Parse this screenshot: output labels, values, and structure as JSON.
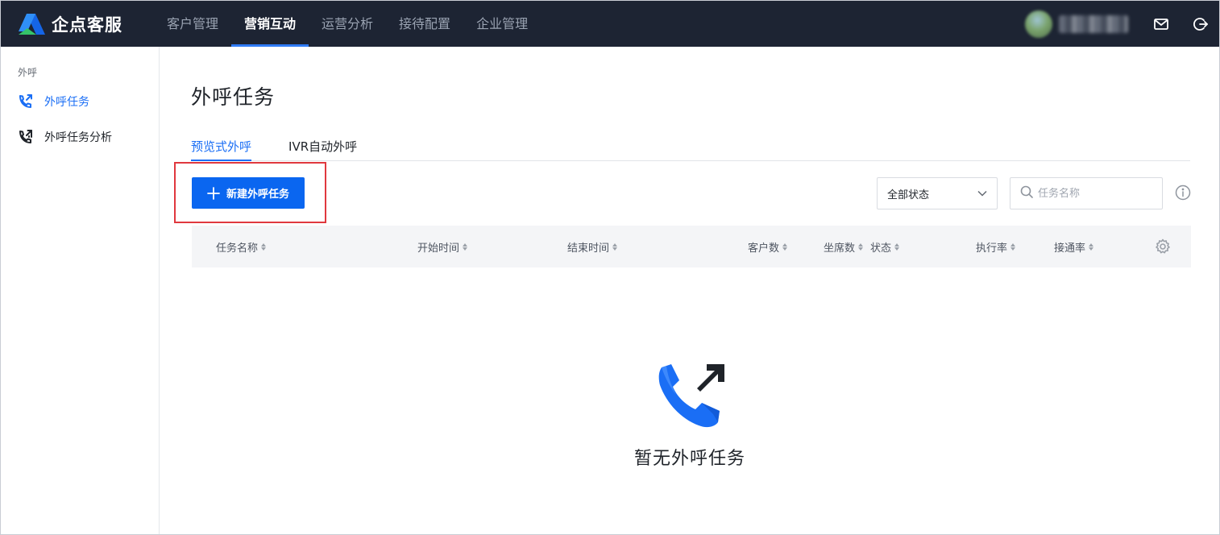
{
  "brand": {
    "name": "企点客服"
  },
  "topnav": {
    "tabs": [
      {
        "label": "客户管理",
        "active": false
      },
      {
        "label": "营销互动",
        "active": true
      },
      {
        "label": "运营分析",
        "active": false
      },
      {
        "label": "接待配置",
        "active": false
      },
      {
        "label": "企业管理",
        "active": false
      }
    ],
    "icons": [
      "mail-icon",
      "logout-icon"
    ]
  },
  "sidebar": {
    "group_label": "外呼",
    "items": [
      {
        "label": "外呼任务",
        "icon": "outbound-call-icon",
        "active": true
      },
      {
        "label": "外呼任务分析",
        "icon": "call-analytics-icon",
        "active": false
      }
    ]
  },
  "main": {
    "title": "外呼任务",
    "subtabs": [
      {
        "label": "预览式外呼",
        "active": true
      },
      {
        "label": "IVR自动外呼",
        "active": false
      }
    ],
    "new_button_label": "新建外呼任务",
    "status_filter": {
      "value": "全部状态"
    },
    "search": {
      "placeholder": "任务名称",
      "value": ""
    },
    "table": {
      "columns": [
        "任务名称",
        "开始时间",
        "结束时间",
        "客户数",
        "坐席数",
        "状态",
        "执行率",
        "接通率"
      ]
    },
    "empty_text": "暂无外呼任务"
  },
  "colors": {
    "nav_bg": "#1d2433",
    "accent": "#1a6ef5",
    "primary_button": "#0a66f0",
    "highlight_border": "#e0383e"
  }
}
